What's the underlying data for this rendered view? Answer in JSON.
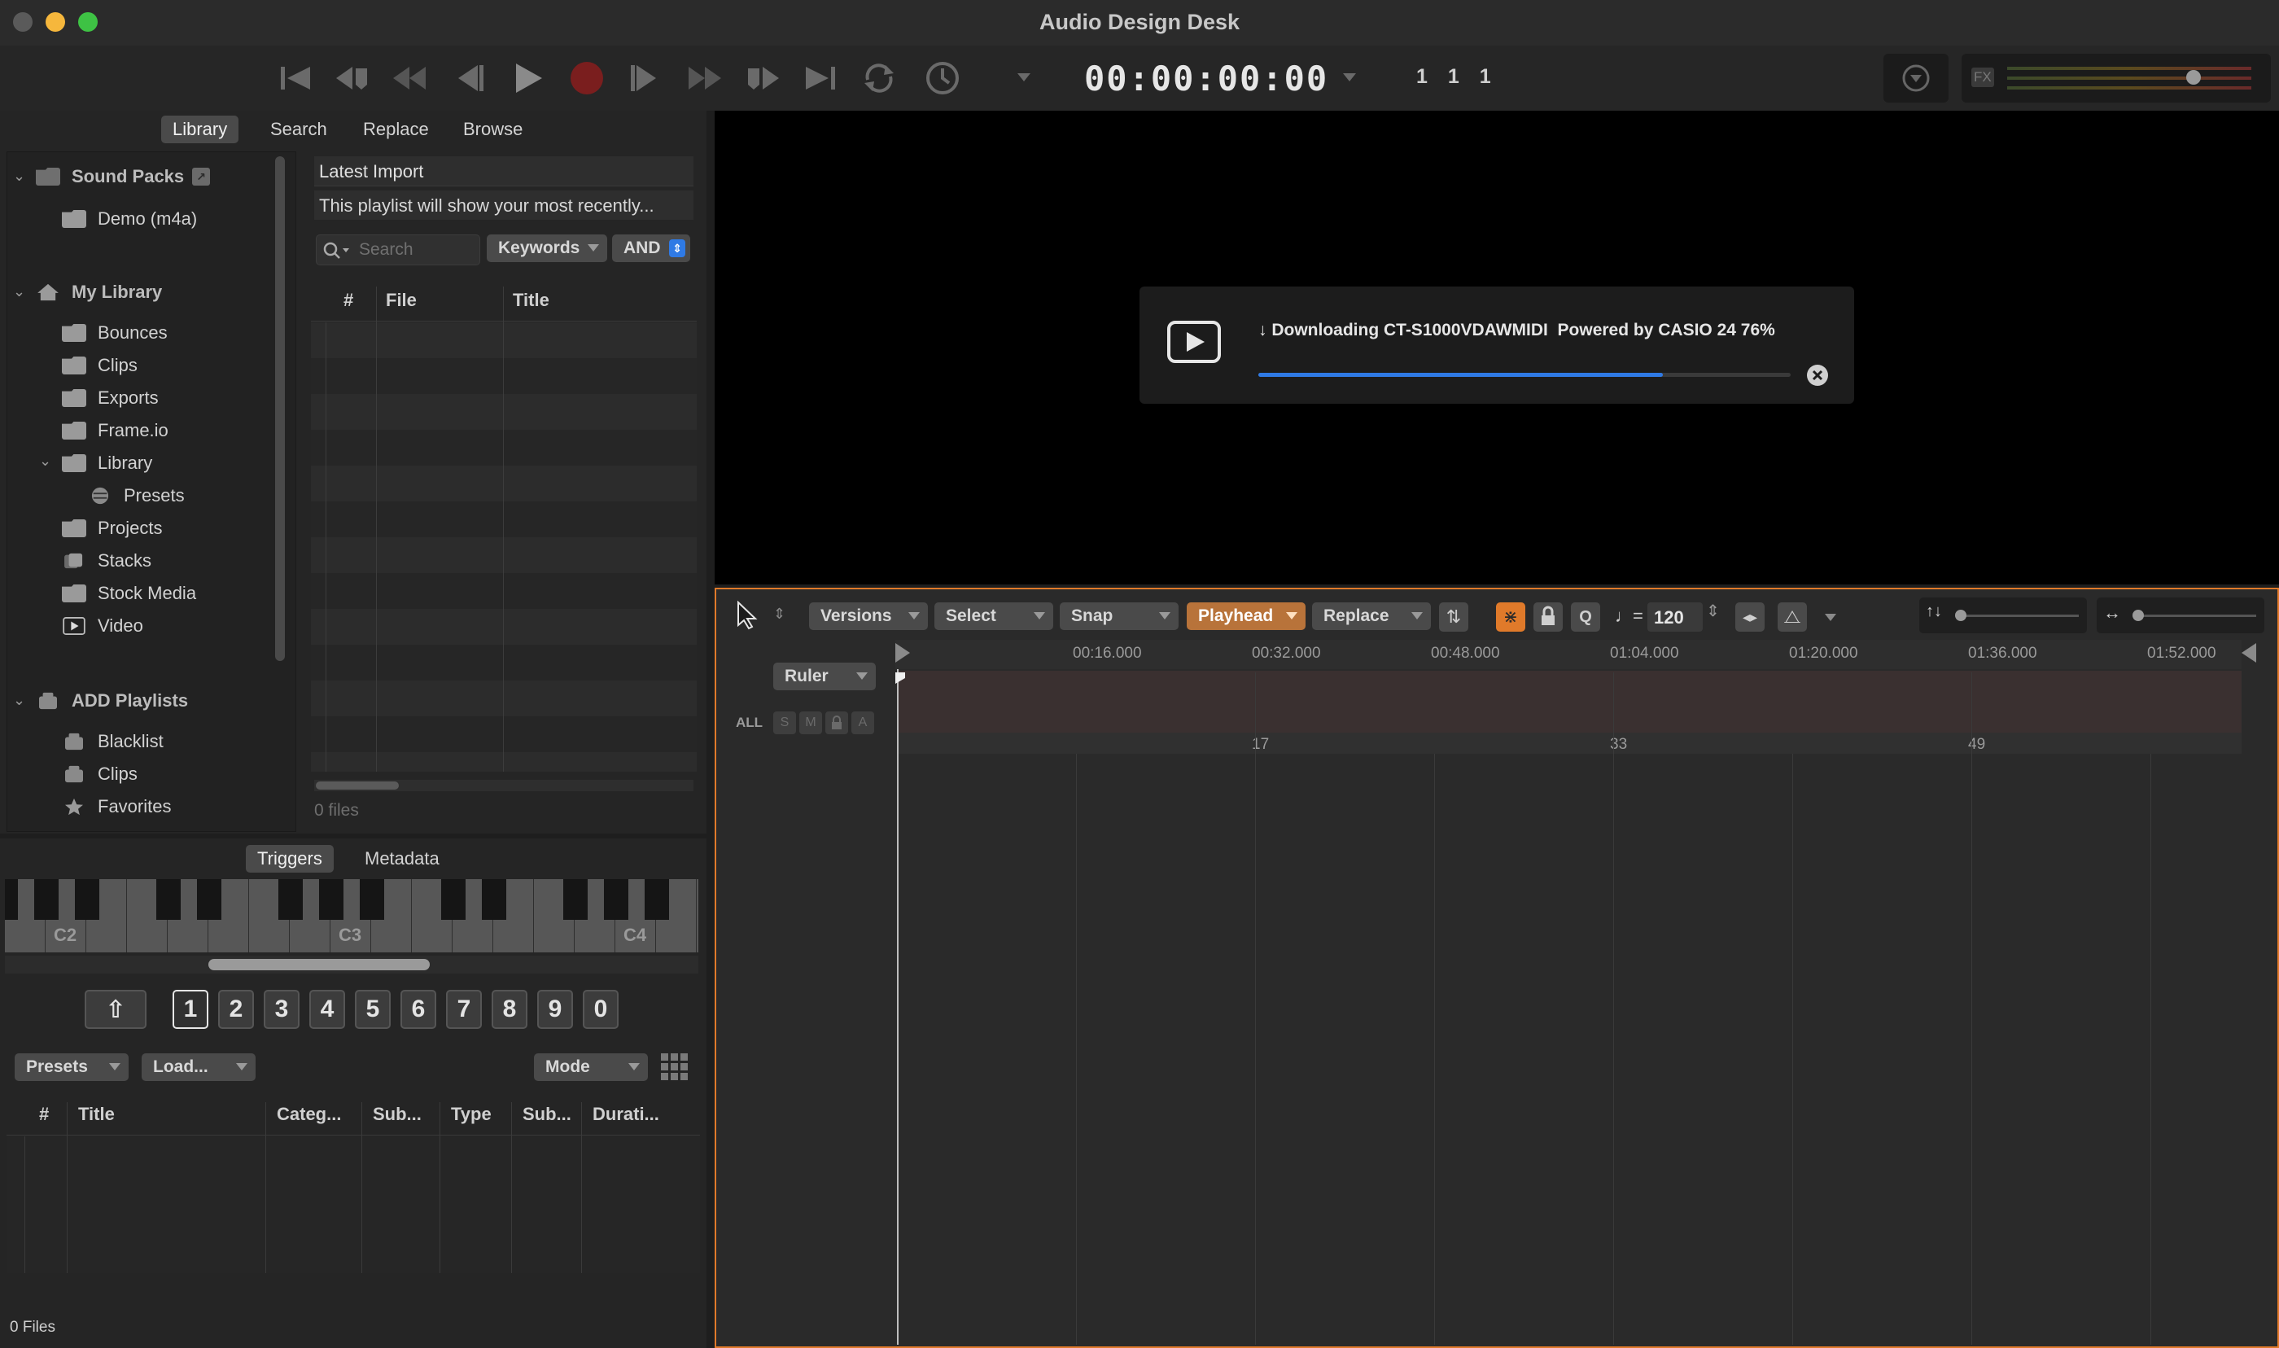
{
  "app": {
    "title": "Audio Design Desk"
  },
  "transport": {
    "timecode": "00:00:00:00",
    "bars_beats": "1 1 1",
    "fx_label": "FX"
  },
  "library_tabs": [
    "Library",
    "Search",
    "Replace",
    "Browse"
  ],
  "sidebar": {
    "sound_packs": {
      "label": "Sound Packs",
      "items": [
        "Demo (m4a)"
      ]
    },
    "my_library": {
      "label": "My Library",
      "items": [
        "Bounces",
        "Clips",
        "Exports",
        "Frame.io",
        "Library",
        "Presets",
        "Projects",
        "Stacks",
        "Stock Media",
        "Video"
      ]
    },
    "add_playlists": {
      "label": "ADD Playlists",
      "items": [
        "Blacklist",
        "Clips",
        "Favorites"
      ]
    }
  },
  "playlist": {
    "title": "Latest Import",
    "description": "This playlist will show your most recently...",
    "search_placeholder": "Search",
    "keywords_label": "Keywords",
    "and_label": "AND",
    "columns": [
      "#",
      "File",
      "Title"
    ],
    "file_count": "0 files"
  },
  "trigger_tabs": [
    "Triggers",
    "Metadata"
  ],
  "keyboard": {
    "octave_labels": [
      "C2",
      "C3",
      "C4"
    ]
  },
  "number_keys": {
    "shift_glyph": "⇧",
    "keys": [
      "1",
      "2",
      "3",
      "4",
      "5",
      "6",
      "7",
      "8",
      "9",
      "0"
    ],
    "selected": "1"
  },
  "trigger_controls": {
    "presets_label": "Presets",
    "load_label": "Load...",
    "mode_label": "Mode"
  },
  "trigger_table": {
    "columns": [
      "#",
      "Title",
      "Categ...",
      "Sub...",
      "Type",
      "Sub...",
      "Durati..."
    ],
    "file_count": "0 Files"
  },
  "download": {
    "text": "↓ Downloading CT-S1000VDAWMIDI  Powered by CASIO 24 76%",
    "progress": 0.76
  },
  "timeline_toolbar": {
    "versions_label": "Versions",
    "select_label": "Select",
    "snap_label": "Snap",
    "playhead_label": "Playhead",
    "replace_label": "Replace",
    "tempo_prefix": "♩=",
    "tempo": "120",
    "vertical_zoom_glyph": "↑↓",
    "horizontal_zoom_glyph": "↔"
  },
  "timeline": {
    "ruler_label": "Ruler",
    "all_label": "ALL",
    "track_buttons": [
      "S",
      "M",
      "",
      "A"
    ],
    "time_markers": [
      "00:16.000",
      "00:32.000",
      "00:48.000",
      "01:04.000",
      "01:20.000",
      "01:36.000",
      "01:52.000"
    ],
    "bar_markers": [
      "17",
      "33",
      "49"
    ]
  },
  "colors": {
    "accent_orange": "#e07a2a",
    "playhead_button": "#b8733a",
    "progress_blue": "#2f7ae5",
    "record_red": "#7a1e1e"
  }
}
